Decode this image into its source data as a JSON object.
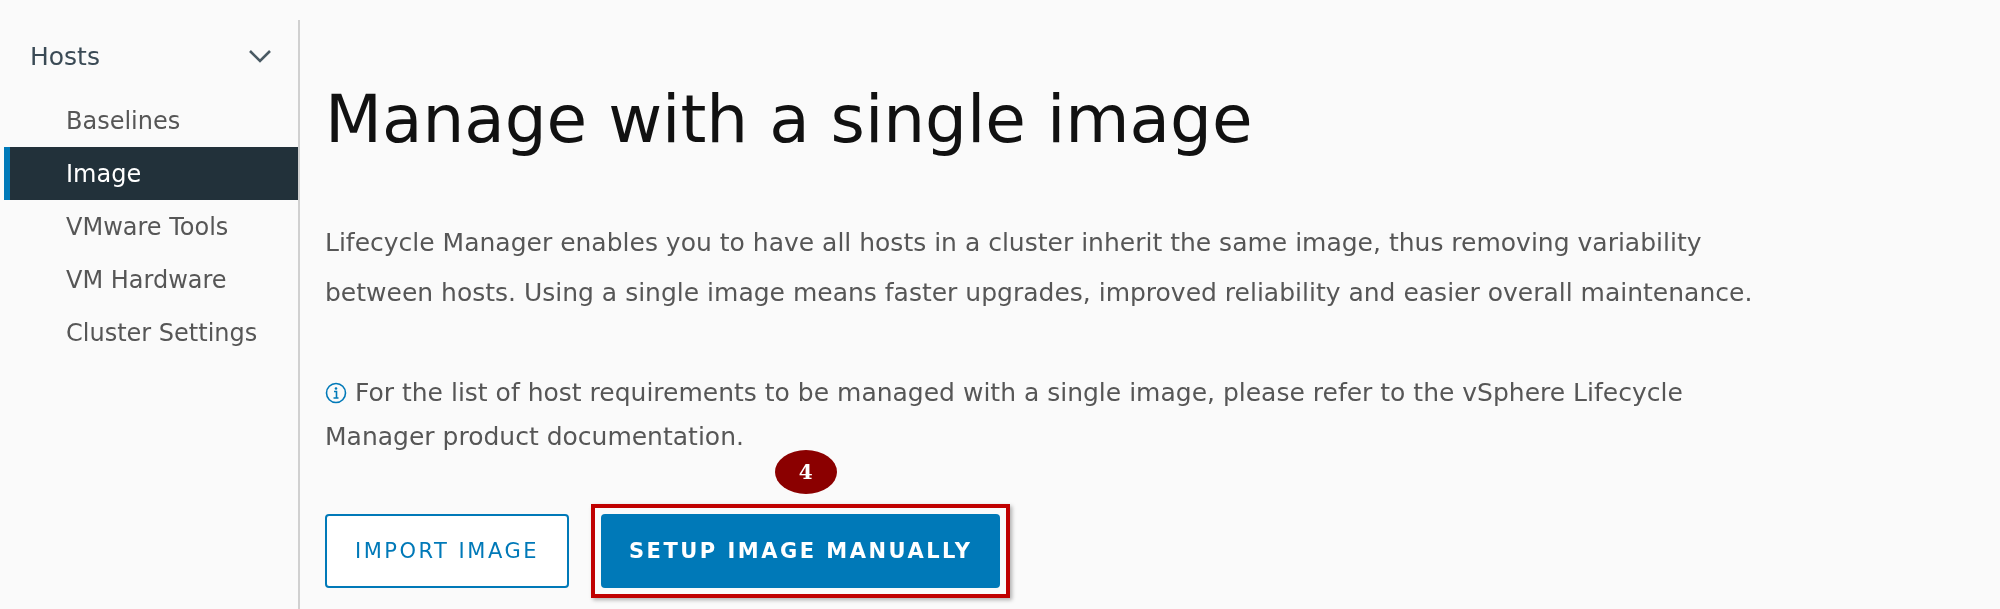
{
  "sidebar": {
    "group": {
      "label": "Hosts",
      "expanded": true
    },
    "items": [
      {
        "label": "Baselines",
        "selected": false
      },
      {
        "label": "Image",
        "selected": true
      },
      {
        "label": "VMware Tools",
        "selected": false
      },
      {
        "label": "VM Hardware",
        "selected": false
      },
      {
        "label": "Cluster Settings",
        "selected": false
      }
    ]
  },
  "main": {
    "title": "Manage with a single image",
    "description": "Lifecycle Manager enables you to have all hosts in a cluster inherit the same image, thus removing variability between hosts. Using a single image means faster upgrades, improved reliability and easier overall maintenance.",
    "info": "For the list of host requirements to be managed with a single image, please refer to the vSphere Lifecycle Manager product documentation.",
    "buttons": [
      {
        "label": "IMPORT IMAGE",
        "kind": "outline",
        "highlighted": false
      },
      {
        "label": "SETUP IMAGE MANUALLY",
        "kind": "primary",
        "highlighted": true,
        "callout": "4"
      }
    ]
  }
}
